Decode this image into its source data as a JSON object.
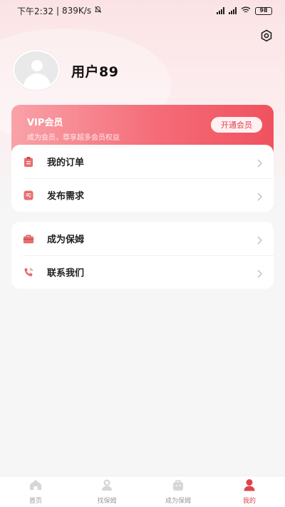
{
  "status_bar": {
    "time": "下午2:32",
    "separator": "|",
    "speed": "839K/s",
    "battery": "98"
  },
  "profile": {
    "username": "用户89"
  },
  "vip": {
    "title": "VIP会员",
    "subtitle": "成为会员，尊享超多会员权益",
    "button": "开通会员"
  },
  "menu_group_1": [
    {
      "label": "我的订单",
      "icon": "clipboard-icon"
    },
    {
      "label": "发布需求",
      "icon": "publish-icon"
    }
  ],
  "menu_group_2": [
    {
      "label": "成为保姆",
      "icon": "briefcase-icon"
    },
    {
      "label": "联系我们",
      "icon": "phone-icon"
    }
  ],
  "tabs": [
    {
      "label": "首页",
      "icon": "home-icon"
    },
    {
      "label": "找保姆",
      "icon": "nanny-icon"
    },
    {
      "label": "成为保姆",
      "icon": "bag-icon"
    },
    {
      "label": "我的",
      "icon": "user-icon",
      "active": true
    }
  ],
  "colors": {
    "accent": "#e0434f",
    "vip_start": "#f9a2a8",
    "vip_end": "#f0525f"
  }
}
